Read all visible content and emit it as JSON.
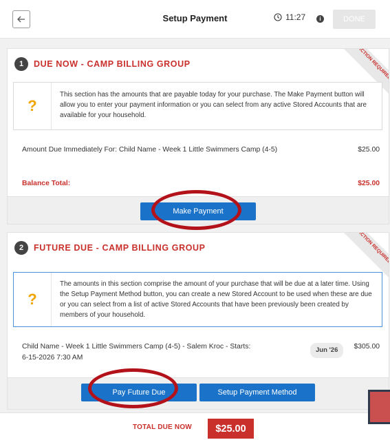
{
  "header": {
    "title": "Setup Payment",
    "back_icon": "arrow-left-icon",
    "timer": "11:27",
    "timer_icon": "clock-icon",
    "info_icon": "info-icon",
    "done_label": "DONE"
  },
  "sections": [
    {
      "number": "1",
      "title": "DUE NOW - CAMP BILLING GROUP",
      "ribbon": "ACTION REQUIRED",
      "info": "This section has the amounts that are payable today for your purchase. The Make Payment button will allow you to enter your payment information or you can select from any active Stored Accounts that are available for your household.",
      "item_desc": "Amount Due Immediately For: Child Name - Week 1 Little Swimmers Camp (4-5)",
      "item_amount": "$25.00",
      "balance_label": "Balance Total:",
      "balance_amount": "$25.00",
      "button": "Make Payment"
    },
    {
      "number": "2",
      "title": "FUTURE DUE - CAMP BILLING GROUP",
      "ribbon": "ACTION REQUIRED",
      "info": "The amounts in this section comprise the amount of your purchase that will be due at a later time. Using the Setup Payment Method button, you can create a new Stored Account to be used when these are due or you can select from a list of active Stored Accounts that have been previously been created by members of your household.",
      "item_desc": "Child Name - Week 1 Little Swimmers Camp (4-5) - Salem Kroc - Starts: 6-15-2026 7:30 AM",
      "item_badge": "Jun '26",
      "item_amount": "$305.00",
      "button_pay": "Pay Future Due",
      "button_setup": "Setup Payment Method"
    }
  ],
  "footer": {
    "total_label": "TOTAL DUE NOW",
    "total_amount": "$25.00"
  },
  "colors": {
    "accent_red": "#c9302c",
    "button_blue": "#1a73c9",
    "question_orange": "#f0a500",
    "highlight_oval": "#b3121a"
  }
}
